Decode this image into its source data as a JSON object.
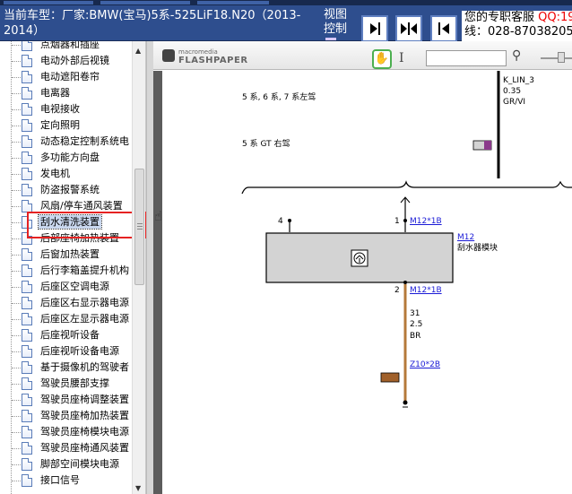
{
  "header": {
    "car_model_line1": "当前车型：厂家:BMW(宝马)5系-525LiF18.N20（2013-",
    "car_model_line2": "2014）",
    "view_control_line1": "视图",
    "view_control_line2": "控制",
    "contact_text": "您的专职客服",
    "contact_qq": "QQ:19",
    "contact_phone": "线：028-87038205"
  },
  "view_buttons": [
    {
      "name": "single-page",
      "icon": "arrow-right-bar-icon"
    },
    {
      "name": "two-page",
      "icon": "arrows-in-icon"
    },
    {
      "name": "prev-page",
      "icon": "arrow-left-bar-icon"
    }
  ],
  "tree": {
    "items": [
      {
        "label": "点烟器和插座"
      },
      {
        "label": "电动外部后视镜"
      },
      {
        "label": "电动遮阳卷帘"
      },
      {
        "label": "电离器"
      },
      {
        "label": "电视接收"
      },
      {
        "label": "定向照明"
      },
      {
        "label": "动态稳定控制系统电"
      },
      {
        "label": "多功能方向盘"
      },
      {
        "label": "发电机"
      },
      {
        "label": "防盗报警系统"
      },
      {
        "label": "风扇/停车通风装置"
      },
      {
        "label": "刮水清洗装置",
        "selected": true
      },
      {
        "label": "后部座椅加热装置"
      },
      {
        "label": "后窗加热装置"
      },
      {
        "label": "后行李箱盖提升机构"
      },
      {
        "label": "后座区空调电源"
      },
      {
        "label": "后座区右显示器电源"
      },
      {
        "label": "后座区左显示器电源"
      },
      {
        "label": "后座视听设备"
      },
      {
        "label": "后座视听设备电源"
      },
      {
        "label": "基于摄像机的驾驶者"
      },
      {
        "label": "驾驶员腰部支撑"
      },
      {
        "label": "驾驶员座椅调整装置"
      },
      {
        "label": "驾驶员座椅加热装置"
      },
      {
        "label": "驾驶员座椅模块电源"
      },
      {
        "label": "驾驶员座椅通风装置"
      },
      {
        "label": "脚部空间模块电源"
      },
      {
        "label": "接口信号"
      }
    ]
  },
  "viewer": {
    "logo_small": "macromedia",
    "logo_big": "FLASHPAPER",
    "search_value": ""
  },
  "diagram": {
    "note1": "5 系, 6 系, 7 系左驾",
    "note2": "5 系 GT 右驾",
    "top_wire_name": "K_LIN_3",
    "top_wire_size": "0.35",
    "top_wire_color": "GR/VI",
    "pin_left": "4",
    "pin_right": "1",
    "pin_ref_top": "M12*1B",
    "module_code": "M12",
    "module_name": "刮水器模块",
    "pin_bottom": "2",
    "pin_ref_bottom": "M12*1B",
    "bottom_wire_name": "31",
    "bottom_wire_size": "2.5",
    "bottom_wire_color": "BR",
    "ground_ref": "Z10*2B",
    "colors": {
      "wire_br": "#b5793a",
      "swatch_br": "#a0602a",
      "swatch_vi": "#8b3a8b",
      "module_fill": "#d3d3d3"
    }
  }
}
